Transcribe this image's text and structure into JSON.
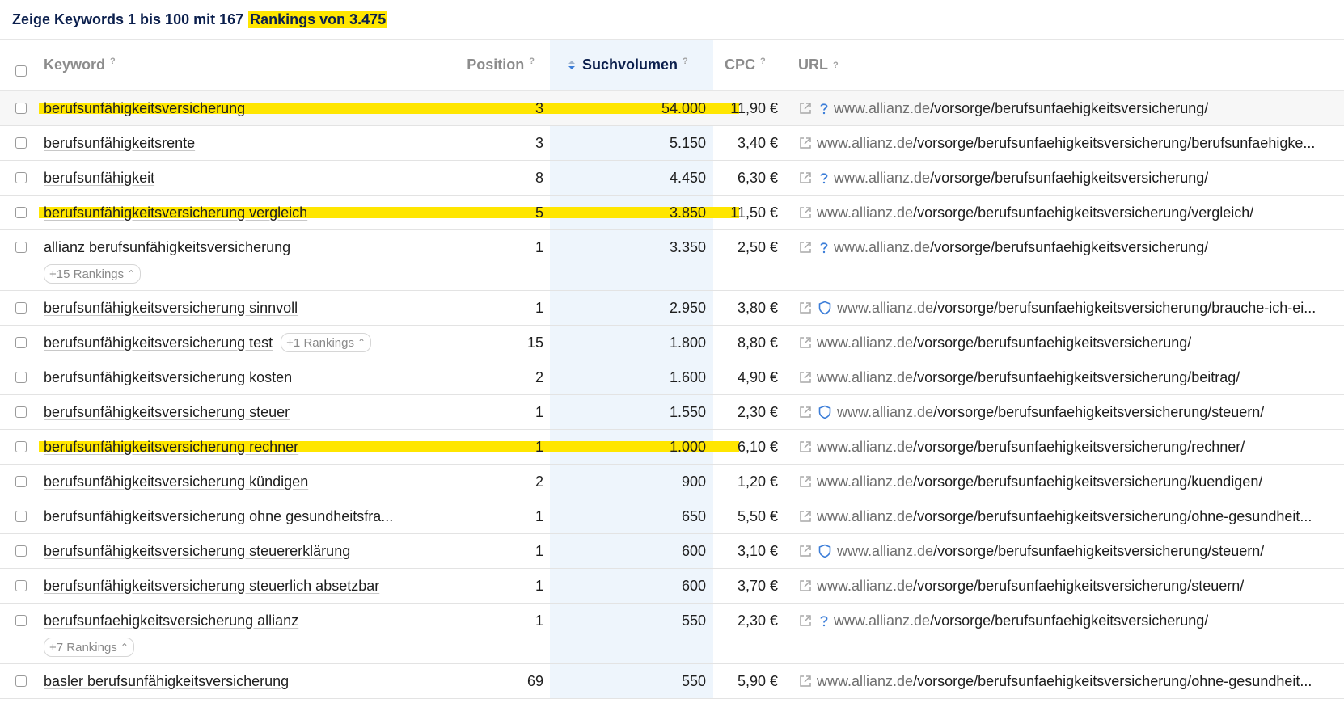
{
  "header": {
    "prefix": "Zeige Keywords 1 bis 100 mit 167",
    "highlighted": "Rankings von 3.475"
  },
  "columns": {
    "keyword": "Keyword",
    "position": "Position",
    "volume": "Suchvolumen",
    "cpc": "CPC",
    "url": "URL",
    "help": "?"
  },
  "colors": {
    "highlight": "#ffe600",
    "sort_column_bg": "#eef5fc",
    "title": "#0b1f4d",
    "icon_blue": "#3b7dd8"
  },
  "rows": [
    {
      "keyword": "berufsunfähigkeitsversicherung",
      "position": "3",
      "volume": "54.000",
      "cpc": "11,90 €",
      "domain": "www.allianz.de",
      "path": "/vorsorge/berufsunfaehigkeitsversicherung/",
      "feature_icon": "question-icon",
      "highlighted": true
    },
    {
      "keyword": "berufsunfähigkeitsrente",
      "position": "3",
      "volume": "5.150",
      "cpc": "3,40 €",
      "domain": "www.allianz.de",
      "path": "/vorsorge/berufsunfaehigkeitsversicherung/berufsunfaehigke...",
      "feature_icon": "",
      "highlighted": false
    },
    {
      "keyword": "berufsunfähigkeit",
      "position": "8",
      "volume": "4.450",
      "cpc": "6,30 €",
      "domain": "www.allianz.de",
      "path": "/vorsorge/berufsunfaehigkeitsversicherung/",
      "feature_icon": "question-icon",
      "highlighted": false
    },
    {
      "keyword": "berufsunfähigkeitsversicherung vergleich",
      "position": "5",
      "volume": "3.850",
      "cpc": "11,50 €",
      "domain": "www.allianz.de",
      "path": "/vorsorge/berufsunfaehigkeitsversicherung/vergleich/",
      "feature_icon": "",
      "highlighted": true
    },
    {
      "keyword": "allianz berufsunfähigkeitsversicherung",
      "position": "1",
      "volume": "3.350",
      "cpc": "2,50 €",
      "domain": "www.allianz.de",
      "path": "/vorsorge/berufsunfaehigkeitsversicherung/",
      "feature_icon": "question-icon",
      "highlighted": false,
      "badge_below": "+15 Rankings"
    },
    {
      "keyword": "berufsunfähigkeitsversicherung sinnvoll",
      "position": "1",
      "volume": "2.950",
      "cpc": "3,80 €",
      "domain": "www.allianz.de",
      "path": "/vorsorge/berufsunfaehigkeitsversicherung/brauche-ich-ei...",
      "feature_icon": "shield-icon",
      "highlighted": false
    },
    {
      "keyword": "berufsunfähigkeitsversicherung test",
      "position": "15",
      "volume": "1.800",
      "cpc": "8,80 €",
      "domain": "www.allianz.de",
      "path": "/vorsorge/berufsunfaehigkeitsversicherung/",
      "feature_icon": "",
      "highlighted": false,
      "badge_inline": "+1 Rankings"
    },
    {
      "keyword": "berufsunfähigkeitsversicherung kosten",
      "position": "2",
      "volume": "1.600",
      "cpc": "4,90 €",
      "domain": "www.allianz.de",
      "path": "/vorsorge/berufsunfaehigkeitsversicherung/beitrag/",
      "feature_icon": "",
      "highlighted": false
    },
    {
      "keyword": "berufsunfähigkeitsversicherung steuer",
      "position": "1",
      "volume": "1.550",
      "cpc": "2,30 €",
      "domain": "www.allianz.de",
      "path": "/vorsorge/berufsunfaehigkeitsversicherung/steuern/",
      "feature_icon": "shield-icon",
      "highlighted": false
    },
    {
      "keyword": "berufsunfähigkeitsversicherung rechner",
      "position": "1",
      "volume": "1.000",
      "cpc": "6,10 €",
      "domain": "www.allianz.de",
      "path": "/vorsorge/berufsunfaehigkeitsversicherung/rechner/",
      "feature_icon": "",
      "highlighted": true
    },
    {
      "keyword": "berufsunfähigkeitsversicherung kündigen",
      "position": "2",
      "volume": "900",
      "cpc": "1,20 €",
      "domain": "www.allianz.de",
      "path": "/vorsorge/berufsunfaehigkeitsversicherung/kuendigen/",
      "feature_icon": "",
      "highlighted": false
    },
    {
      "keyword": "berufsunfähigkeitsversicherung ohne gesundheitsfra...",
      "position": "1",
      "volume": "650",
      "cpc": "5,50 €",
      "domain": "www.allianz.de",
      "path": "/vorsorge/berufsunfaehigkeitsversicherung/ohne-gesundheit...",
      "feature_icon": "",
      "highlighted": false
    },
    {
      "keyword": "berufsunfähigkeitsversicherung steuererklärung",
      "position": "1",
      "volume": "600",
      "cpc": "3,10 €",
      "domain": "www.allianz.de",
      "path": "/vorsorge/berufsunfaehigkeitsversicherung/steuern/",
      "feature_icon": "shield-icon",
      "highlighted": false
    },
    {
      "keyword": "berufsunfähigkeitsversicherung steuerlich absetzbar",
      "position": "1",
      "volume": "600",
      "cpc": "3,70 €",
      "domain": "www.allianz.de",
      "path": "/vorsorge/berufsunfaehigkeitsversicherung/steuern/",
      "feature_icon": "",
      "highlighted": false
    },
    {
      "keyword": "berufsunfaehigkeitsversicherung allianz",
      "position": "1",
      "volume": "550",
      "cpc": "2,30 €",
      "domain": "www.allianz.de",
      "path": "/vorsorge/berufsunfaehigkeitsversicherung/",
      "feature_icon": "question-icon",
      "highlighted": false,
      "badge_below": "+7 Rankings"
    },
    {
      "keyword": "basler berufsunfähigkeitsversicherung",
      "position": "69",
      "volume": "550",
      "cpc": "5,90 €",
      "domain": "www.allianz.de",
      "path": "/vorsorge/berufsunfaehigkeitsversicherung/ohne-gesundheit...",
      "feature_icon": "",
      "highlighted": false
    }
  ]
}
